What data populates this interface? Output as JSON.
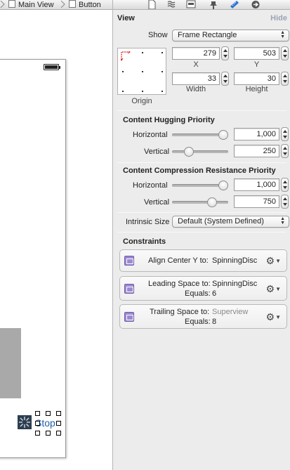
{
  "breadcrumb": {
    "items": [
      "Main View",
      "Button"
    ]
  },
  "canvas": {
    "button_title": "Stop"
  },
  "toolbar": {
    "icons": [
      "file-icon",
      "help-icon",
      "identity-icon",
      "attributes-icon",
      "size-icon",
      "connections-icon"
    ]
  },
  "view": {
    "title": "View",
    "hide_label": "Hide",
    "show_label": "Show",
    "show_value": "Frame Rectangle",
    "origin_label": "Origin",
    "x": {
      "value": "279",
      "label": "X"
    },
    "y": {
      "value": "503",
      "label": "Y"
    },
    "width": {
      "value": "33",
      "label": "Width"
    },
    "height": {
      "value": "30",
      "label": "Height"
    }
  },
  "hugging": {
    "title": "Content Hugging Priority",
    "horizontal": {
      "label": "Horizontal",
      "value": "1,000",
      "fraction": 1.0
    },
    "vertical": {
      "label": "Vertical",
      "value": "250",
      "fraction": 0.25
    }
  },
  "compression": {
    "title": "Content Compression Resistance Priority",
    "horizontal": {
      "label": "Horizontal",
      "value": "1,000",
      "fraction": 1.0
    },
    "vertical": {
      "label": "Vertical",
      "value": "750",
      "fraction": 0.75
    }
  },
  "intrinsic": {
    "label": "Intrinsic Size",
    "value": "Default (System Defined)"
  },
  "constraints": {
    "title": "Constraints",
    "items": [
      {
        "line1_label": "Align Center Y to:",
        "line1_value": "SpinningDisc"
      },
      {
        "line1_label": "Leading Space to:",
        "line1_value": "SpinningDisc",
        "line2_label": "Equals:",
        "line2_value": "6"
      },
      {
        "line1_label": "Trailing Space to:",
        "line1_value": "Superview",
        "line2_label": "Equals:",
        "line2_value": "8"
      }
    ]
  },
  "colors": {
    "accent": "#1f5fa8",
    "constraint_icon": "#9c8ad0",
    "panel_bg": "#ececec"
  }
}
